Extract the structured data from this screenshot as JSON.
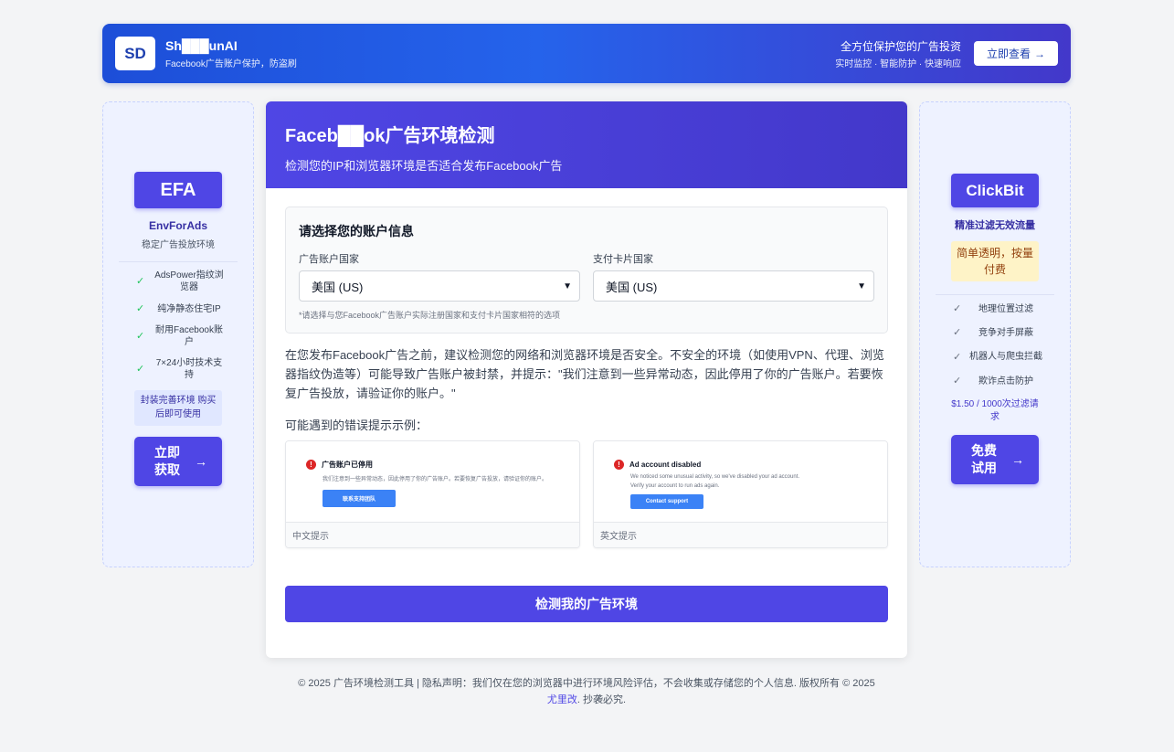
{
  "banner": {
    "logo": "SD",
    "brand_name": "Sh███unAI",
    "brand_sub": "Facebook广告账户保护，防盗刷",
    "headline": "全方位保护您的广告投资",
    "subline": "实时监控 · 智能防护 · 快速响应",
    "cta_label": "立即查看",
    "cta_arrow": "→"
  },
  "left_ad": {
    "badge": "EFA",
    "name": "EnvForAds",
    "desc": "稳定广告投放环境",
    "features": [
      "AdsPower指纹浏览器",
      "纯净静态住宅IP",
      "耐用Facebook账户",
      "7×24小时技术支持"
    ],
    "note": "封装完善环境 购买后即可使用",
    "cta": "立即获取",
    "cta_arrow": "→"
  },
  "right_ad": {
    "badge": "ClickBit",
    "tagline": "精准过滤无效流量",
    "price_box": "简单透明，按量付费",
    "features": [
      "地理位置过滤",
      "竞争对手屏蔽",
      "机器人与爬虫拦截",
      "欺诈点击防护"
    ],
    "price_note": "$1.50 / 1000次过滤请求",
    "cta": "免费试用",
    "cta_arrow": "→"
  },
  "main": {
    "title": "Faceb██ok广告环境检测",
    "subtitle": "检测您的IP和浏览器环境是否适合发布Facebook广告",
    "account": {
      "title": "请选择您的账户信息",
      "ad_country_label": "广告账户国家",
      "ad_country_value": "美国 (US)",
      "card_country_label": "支付卡片国家",
      "card_country_value": "美国 (US)",
      "hint": "*请选择与您Facebook广告账户实际注册国家和支付卡片国家相符的选项"
    },
    "paragraph": "在您发布Facebook广告之前，建议检测您的网络和浏览器环境是否安全。不安全的环境（如使用VPN、代理、浏览器指纹伪造等）可能导致广告账户被封禁，并提示：\"我们注意到一些异常动态，因此停用了你的广告账户。若要恢复广告投放，请验证你的账户。\"",
    "examples_label": "可能遇到的错误提示示例：",
    "examples": [
      {
        "title": "广告账户已停用",
        "lines": [
          "我们注意到一些异常动态，因此停用了你的广告账户。若要恢复广告投放，请验证你的账户。"
        ],
        "button": "联系支持团队",
        "caption": "中文提示"
      },
      {
        "title": "Ad account disabled",
        "lines": [
          "We noticed some unusual activity, so we've disabled your ad account.",
          "Verify your account to run ads again."
        ],
        "button": "Contact support",
        "caption": "英文提示"
      }
    ],
    "check_button": "检测我的广告环境"
  },
  "footer": {
    "text": "© 2025 广告环境检测工具 | 隐私声明：我们仅在您的浏览器中进行环境风险评估，不会收集或存储您的个人信息. 版权所有 © 2025",
    "link": "尤里改",
    "tail": ". 抄袭必究."
  },
  "colors": {
    "primary": "#4f46e5",
    "banner_start": "#1d4ed8",
    "banner_end": "#4338ca",
    "check": "#22c55e",
    "error": "#dc2626"
  }
}
